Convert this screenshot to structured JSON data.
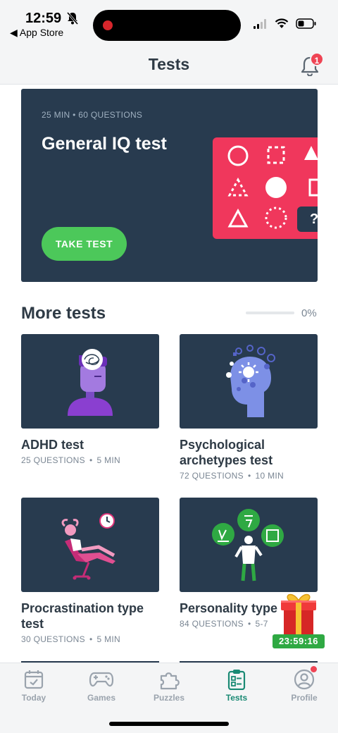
{
  "status_bar": {
    "time": "12:59",
    "back_label": "App Store"
  },
  "header": {
    "title": "Tests",
    "notification_count": "1"
  },
  "hero": {
    "minutes": "25 MIN",
    "questions": "60 QUESTIONS",
    "title": "General IQ test",
    "button_label": "TAKE TEST",
    "puzzle_placeholder": "?"
  },
  "more_tests": {
    "title": "More tests",
    "progress": 0,
    "progress_text": "0%"
  },
  "tests": [
    {
      "title": "ADHD test",
      "questions": "25 QUESTIONS",
      "minutes": "5 MIN"
    },
    {
      "title": "Psychological archetypes test",
      "questions": "72 QUESTIONS",
      "minutes": "10 MIN"
    },
    {
      "title": "Procrastination type test",
      "questions": "30 QUESTIONS",
      "minutes": "5 MIN"
    },
    {
      "title": "Personality type",
      "questions": "84 QUESTIONS",
      "minutes": "5-7"
    }
  ],
  "gift": {
    "timer": "23:59:16"
  },
  "tabbar": {
    "today": "Today",
    "games": "Games",
    "puzzles": "Puzzles",
    "tests": "Tests",
    "profile": "Profile"
  },
  "colors": {
    "card_bg": "#283b4f",
    "accent_green": "#4cc85a",
    "puzzle_red": "#f0375c",
    "active_tab": "#1a8a74",
    "badge_red": "#ef4454"
  }
}
